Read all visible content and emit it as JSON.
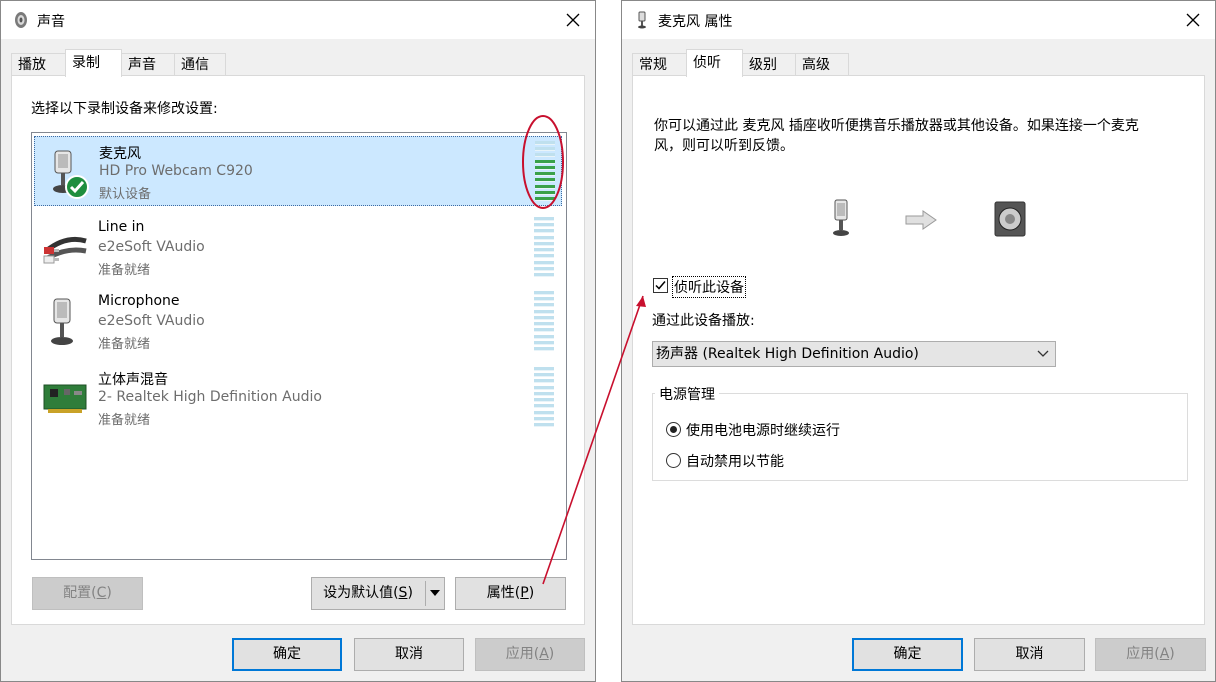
{
  "left_window": {
    "title": "声音",
    "tabs": [
      "播放",
      "录制",
      "声音",
      "通信"
    ],
    "active_tab": "录制",
    "instruction": "选择以下录制设备来修改设置:",
    "devices": [
      {
        "name": "麦克风",
        "sub": "HD Pro Webcam C920",
        "status": "默认设备",
        "icon": "webcam-microphone-icon",
        "default": true
      },
      {
        "name": "Line in",
        "sub": "e2eSoft VAudio",
        "status": "准备就绪",
        "icon": "audio-cable-icon",
        "default": false
      },
      {
        "name": "Microphone",
        "sub": "e2eSoft VAudio",
        "status": "准备就绪",
        "icon": "microphone-icon",
        "default": false
      },
      {
        "name": "立体声混音",
        "sub": "2- Realtek High Definition Audio",
        "status": "准备就绪",
        "icon": "sound-card-icon",
        "default": false
      }
    ],
    "buttons": {
      "configure": "配置(",
      "configure_key": "C",
      "configure_end": ")",
      "set_default": "设为默认值(",
      "set_default_key": "S",
      "set_default_end": ")",
      "properties": "属性(",
      "properties_key": "P",
      "properties_end": ")",
      "ok": "确定",
      "cancel": "取消",
      "apply": "应用(",
      "apply_key": "A",
      "apply_end": ")"
    }
  },
  "right_window": {
    "title": "麦克风 属性",
    "tabs": [
      "常规",
      "侦听",
      "级别",
      "高级"
    ],
    "active_tab": "侦听",
    "description_line1": "你可以通过此 麦克风 插座收听便携音乐播放器或其他设备。如果连接一个麦克",
    "description_line2": "风，则可以听到反馈。",
    "listen_checkbox_label": "侦听此设备",
    "listen_checked": true,
    "playback_label": "通过此设备播放:",
    "playback_device": "扬声器 (Realtek High Definition Audio)",
    "power_group_title": "电源管理",
    "power_options": [
      "使用电池电源时继续运行",
      "自动禁用以节能"
    ],
    "power_selected": 0,
    "buttons": {
      "ok": "确定",
      "cancel": "取消",
      "apply": "应用(",
      "apply_key": "A",
      "apply_end": ")"
    }
  },
  "annotation_color": "#c8102e",
  "meter_colors": {
    "lit": "#3aa14a",
    "idle": "#bfe0ee"
  }
}
